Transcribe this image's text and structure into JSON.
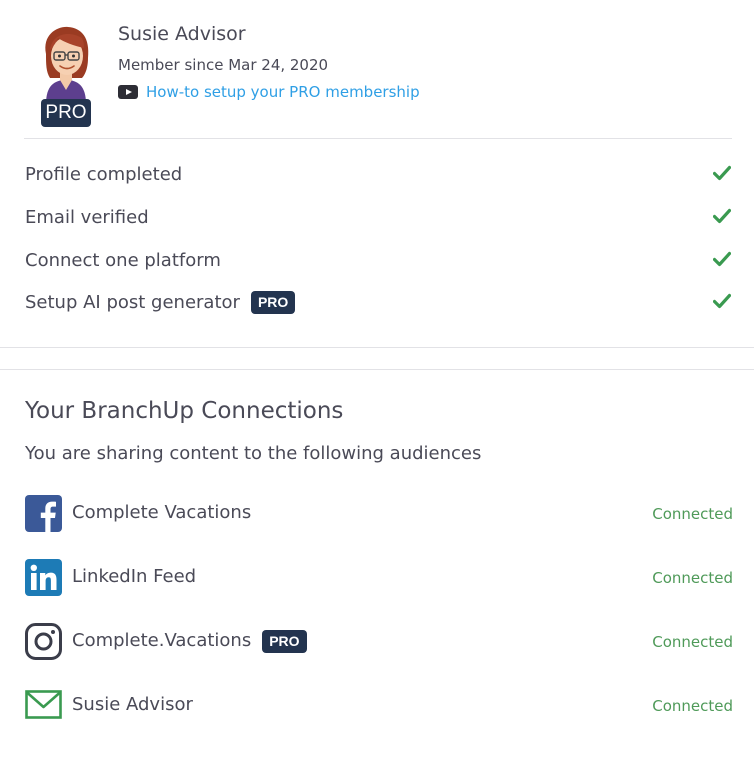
{
  "profile": {
    "name": "Susie Advisor",
    "member_since": "Member since Mar 24, 2020",
    "howto_link": "How-to setup your PRO membership",
    "avatar_badge": "PRO"
  },
  "checklist": [
    {
      "label": "Profile completed",
      "pro": false,
      "done": true
    },
    {
      "label": "Email verified",
      "pro": false,
      "done": true
    },
    {
      "label": "Connect one platform",
      "pro": false,
      "done": true
    },
    {
      "label": "Setup AI post generator",
      "pro": true,
      "pro_label": "PRO",
      "done": true
    }
  ],
  "connections": {
    "title": "Your BranchUp Connections",
    "subtitle": "You are sharing content to the following audiences",
    "items": [
      {
        "platform": "facebook-icon",
        "name": "Complete Vacations",
        "pro": false,
        "status": "Connected"
      },
      {
        "platform": "linkedin-icon",
        "name": "LinkedIn Feed",
        "pro": false,
        "status": "Connected"
      },
      {
        "platform": "instagram-icon",
        "name": "Complete.Vacations",
        "pro": true,
        "pro_label": "PRO",
        "status": "Connected"
      },
      {
        "platform": "email-icon",
        "name": "Susie Advisor",
        "pro": false,
        "status": "Connected"
      }
    ]
  },
  "colors": {
    "pro_badge": "#23344f",
    "link": "#2f9fe5",
    "connected": "#4f9a59",
    "check": "#3a9a50",
    "facebook": "#3b5998",
    "linkedin": "#1d7bb6"
  }
}
